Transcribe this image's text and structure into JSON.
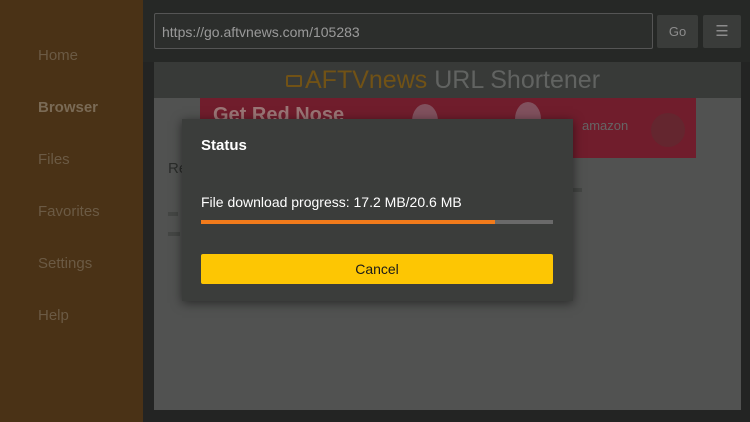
{
  "sidebar": {
    "items": [
      {
        "label": "Home"
      },
      {
        "label": "Browser"
      },
      {
        "label": "Files"
      },
      {
        "label": "Favorites"
      },
      {
        "label": "Settings"
      },
      {
        "label": "Help"
      }
    ],
    "active_item": "Browser"
  },
  "browser": {
    "url": "https://go.aftvnews.com/105283",
    "go_label": "Go",
    "menu_icon": "menu-icon"
  },
  "page": {
    "title_brand": "AFTVnews",
    "title_rest": " URL Shortener",
    "ad_headline": "Get Red Nose",
    "ad_brand": "amazon",
    "text_fragment": "Re"
  },
  "dialog": {
    "title": "Status",
    "progress_text": "File download progress: 17.2 MB/20.6 MB",
    "progress_fraction": 0.835,
    "cancel_label": "Cancel"
  },
  "colors": {
    "accent_progress": "#f27b1b",
    "cancel_button": "#fdc603",
    "sidebar": "#4a3216"
  }
}
